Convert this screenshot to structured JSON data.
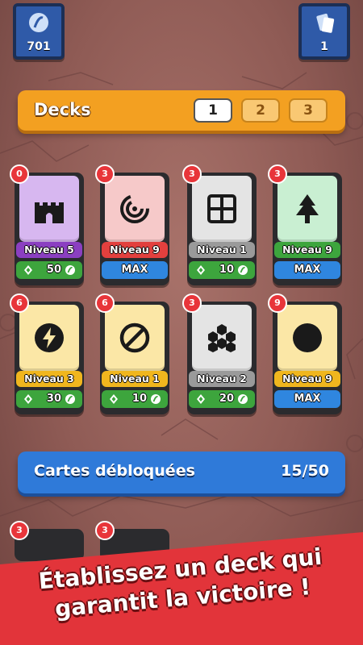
{
  "top_left": {
    "icon": "coin-icon",
    "value": "701"
  },
  "top_right": {
    "icon": "card-icon",
    "value": "1"
  },
  "decks": {
    "title": "Decks",
    "tabs": [
      "1",
      "2",
      "3"
    ],
    "active_tab": "1"
  },
  "cards": [
    {
      "badge": "0",
      "icon": "castle-icon",
      "level": "Niveau 5",
      "cost": "50",
      "max": "",
      "art_color": "#d7b7f0",
      "level_color": "#8b3fc1"
    },
    {
      "badge": "3",
      "icon": "vortex-icon",
      "level": "Niveau 9",
      "cost": "",
      "max": "MAX",
      "art_color": "#f6c9c9",
      "level_color": "#e2403e"
    },
    {
      "badge": "3",
      "icon": "grid-icon",
      "level": "Niveau 1",
      "cost": "10",
      "max": "",
      "art_color": "#e4e4e4",
      "level_color": "#9a9a9a"
    },
    {
      "badge": "3",
      "icon": "tree-icon",
      "level": "Niveau 9",
      "cost": "",
      "max": "MAX",
      "art_color": "#c9efd2",
      "level_color": "#3da53d"
    },
    {
      "badge": "6",
      "icon": "lightning-icon",
      "level": "Niveau 3",
      "cost": "30",
      "max": "",
      "art_color": "#fbe7a6",
      "level_color": "#f0b61e"
    },
    {
      "badge": "6",
      "icon": "prohibited-icon",
      "level": "Niveau 1",
      "cost": "10",
      "max": "",
      "art_color": "#fbe7a6",
      "level_color": "#f0b61e"
    },
    {
      "badge": "3",
      "icon": "hexagons-icon",
      "level": "Niveau 2",
      "cost": "20",
      "max": "",
      "art_color": "#e4e4e4",
      "level_color": "#9a9a9a"
    },
    {
      "badge": "9",
      "icon": "circle-icon",
      "level": "Niveau 9",
      "cost": "",
      "max": "MAX",
      "art_color": "#fbe7a6",
      "level_color": "#f0b61e"
    }
  ],
  "unlocked": {
    "label": "Cartes débloquées",
    "count": "15/50"
  },
  "peek_badges": [
    "3",
    "3"
  ],
  "banner": {
    "line1": "Établissez un deck qui",
    "line2": "garantit la victoire !"
  }
}
